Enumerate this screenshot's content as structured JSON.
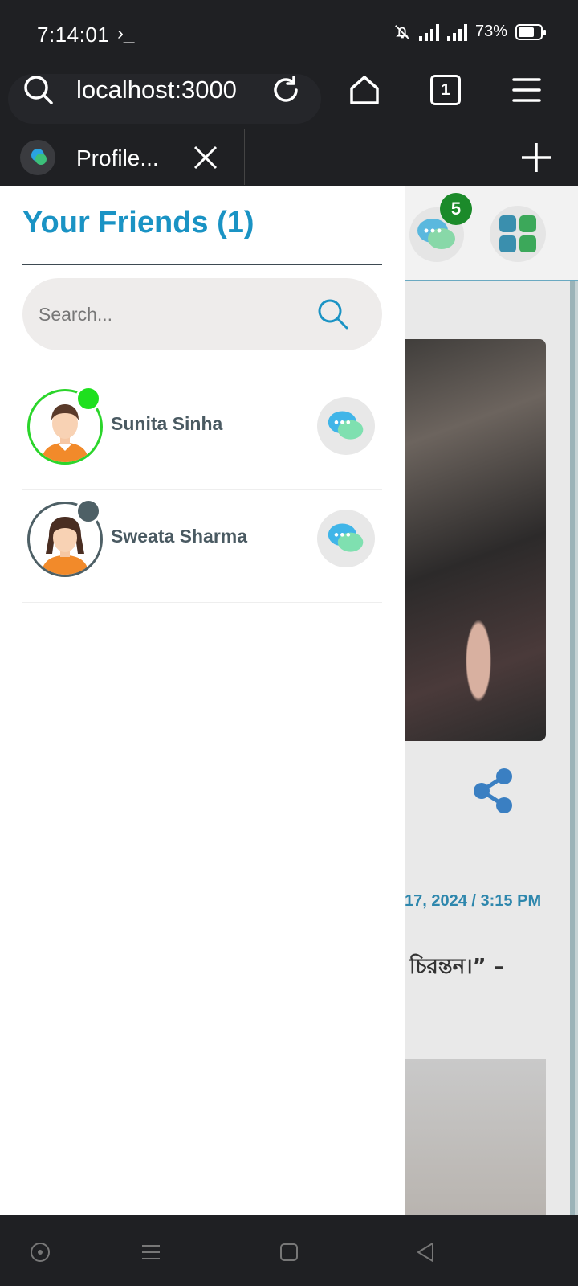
{
  "status_bar": {
    "time": "7:14:01",
    "terminal_glyph": "›_",
    "battery_percent": "73%",
    "battery_level": 0.73
  },
  "browser": {
    "url": "localhost:3000",
    "tab_count": "1",
    "tab_title": "Profile..."
  },
  "background_page": {
    "notification_count": "5",
    "post_date": "17, 2024 / 3:15 PM",
    "quote_fragment": "চিরন্তন।” –"
  },
  "friends_panel": {
    "title": "Your Friends (1)",
    "search_placeholder": "Search...",
    "friends": [
      {
        "name": "Sunita Sinha",
        "status": "online",
        "status_color": "#1ee01e",
        "avatar": "male-avatar-icon"
      },
      {
        "name": "Sweata Sharma",
        "status": "offline",
        "status_color": "#4e6066",
        "avatar": "female-avatar-icon"
      }
    ]
  },
  "colors": {
    "accent": "#1a93c4",
    "online": "#1ee01e",
    "badge": "#1b8a2a"
  }
}
